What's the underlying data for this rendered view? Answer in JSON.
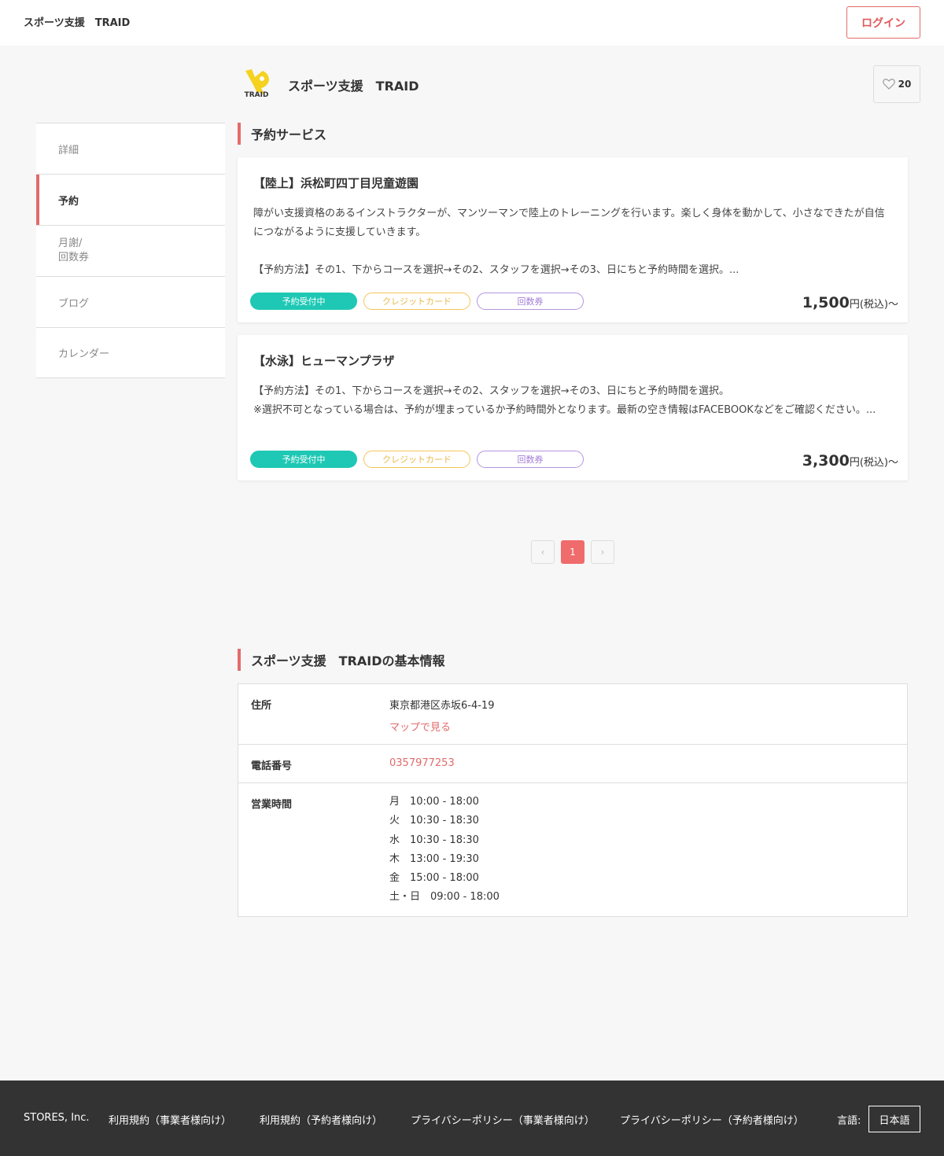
{
  "header": {
    "site_title": "スポーツ支援　TRAID",
    "login_label": "ログイン"
  },
  "store": {
    "name": "スポーツ支援　TRAID",
    "logo_text": "TRAID",
    "favorite_count": "20"
  },
  "sidebar": {
    "items": [
      {
        "label": "詳細"
      },
      {
        "label": "予約"
      },
      {
        "label": "月謝/\n回数券"
      },
      {
        "label": "ブログ"
      },
      {
        "label": "カレンダー"
      }
    ]
  },
  "services": {
    "heading": "予約サービス",
    "items": [
      {
        "title": "【陸上】浜松町四丁目児童遊園",
        "description": "障がい支援資格のあるインストラクターが、マンツーマンで陸上のトレーニングを行います。楽しく身体を動かして、小さなできたが自信につながるように支援していきます。\n\n【予約方法】その1、下からコースを選択→その2、スタッフを選択→その3、日にちと予約時間を選択。...",
        "tags": [
          "予約受付中",
          "クレジットカード",
          "回数券"
        ],
        "price": "1,500",
        "price_suffix": "円(税込)〜"
      },
      {
        "title": "【水泳】ヒューマンプラザ",
        "description": "【予約方法】その1、下からコースを選択→その2、スタッフを選択→その3、日にちと予約時間を選択。\n※選択不可となっている場合は、予約が埋まっているか予約時間外となります。最新の空き情報はFACEBOOKなどをご確認ください。...",
        "tags": [
          "予約受付中",
          "クレジットカード",
          "回数券"
        ],
        "price": "3,300",
        "price_suffix": "円(税込)〜"
      }
    ]
  },
  "pagination": {
    "prev": "‹",
    "current": "1",
    "next": "›"
  },
  "basic_info": {
    "heading": "スポーツ支援　TRAIDの基本情報",
    "address_label": "住所",
    "address": "東京都港区赤坂6-4-19",
    "map_link": "マップで見る",
    "phone_label": "電話番号",
    "phone": "0357977253",
    "hours_label": "営業時間",
    "hours": [
      "月　10:00 - 18:00",
      "火　10:30 - 18:30",
      "水　10:30 - 18:30",
      "木　13:00 - 19:30",
      "金　15:00 - 18:00",
      "土・日　09:00 - 18:00"
    ]
  },
  "footer": {
    "company": "STORES, Inc.",
    "links": [
      "利用規約（事業者様向け）",
      "利用規約（予約者様向け）",
      "プライバシーポリシー（事業者様向け）",
      "プライバシーポリシー（予約者様向け）"
    ],
    "language_label": "言語:",
    "language_value": "日本語"
  },
  "colors": {
    "accent": "#e26b6b",
    "tag_open": "#1ec8b4",
    "tag_credit": "#f3c55a",
    "tag_ticket": "#b294e0",
    "footer_bg": "#333333"
  }
}
